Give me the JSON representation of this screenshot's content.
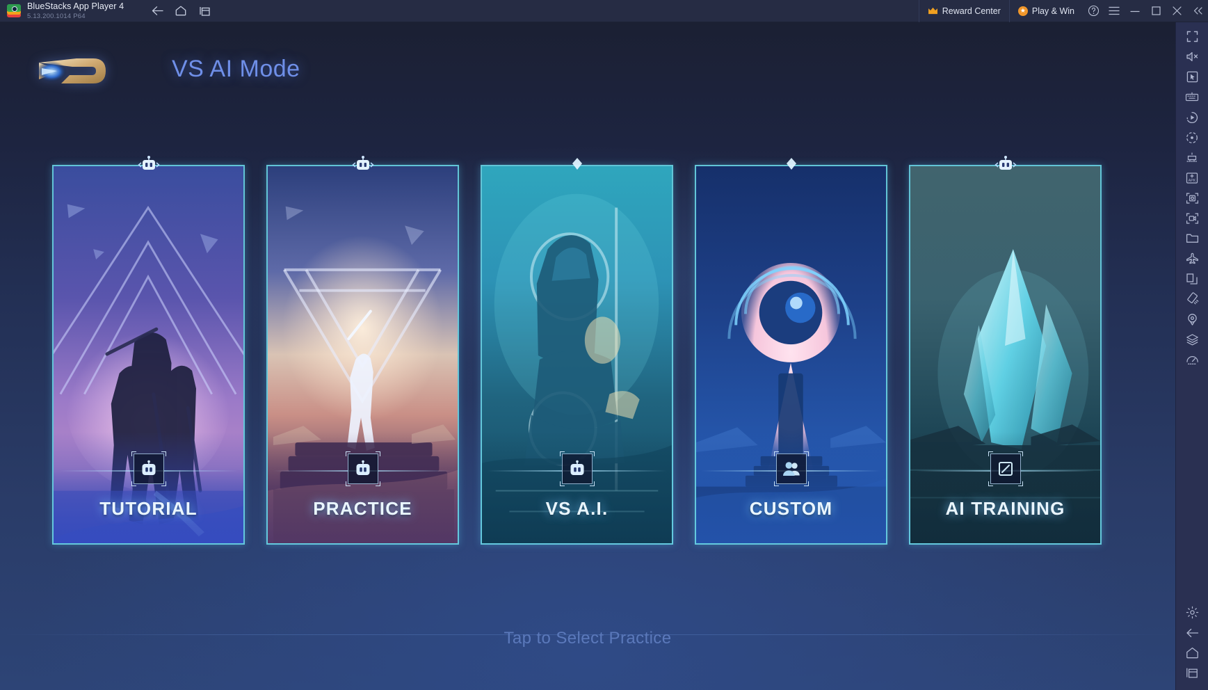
{
  "titlebar": {
    "logo_icon": "bluestacks-logo",
    "app_title": "BlueStacks App Player 4",
    "app_version": "5.13.200.1014  P64",
    "nav": [
      {
        "name": "back",
        "icon": "arrow-left-icon",
        "label": "Back"
      },
      {
        "name": "home",
        "icon": "home-icon",
        "label": "Home"
      },
      {
        "name": "multi-instance",
        "icon": "multi-instance-icon",
        "label": "Instance Manager"
      }
    ],
    "reward_center": {
      "label": "Reward Center",
      "icon": "crown-icon"
    },
    "play_and_win": {
      "label": "Play & Win",
      "icon": "coin-icon"
    },
    "help": {
      "icon": "help-circle-icon",
      "label": "Help"
    },
    "menu": {
      "icon": "hamburger-menu-icon",
      "label": "Menu"
    },
    "minimize": {
      "icon": "minimize-icon",
      "label": "Minimize"
    },
    "maximize": {
      "icon": "maximize-icon",
      "label": "Maximize"
    },
    "close": {
      "icon": "close-icon",
      "label": "Close"
    },
    "collapse": {
      "icon": "chevron-double-left-icon",
      "label": "Collapse Sidebar"
    }
  },
  "sidebar": {
    "items": [
      {
        "icon": "fullscreen-icon",
        "label": "Full screen"
      },
      {
        "icon": "mute-icon",
        "label": "Mute"
      },
      {
        "icon": "cursor-icon",
        "label": "Game controls"
      },
      {
        "icon": "keyboard-icon",
        "label": "Keymapping"
      },
      {
        "icon": "macro-play-icon",
        "label": "Macro recorder"
      },
      {
        "icon": "eco-mode-icon",
        "label": "Eco mode"
      },
      {
        "icon": "multi-instance-sync-icon",
        "label": "Multi-instance sync"
      },
      {
        "icon": "install-apk-icon",
        "label": "Install APK"
      },
      {
        "icon": "screenshot-icon",
        "label": "Screenshot"
      },
      {
        "icon": "record-screen-icon",
        "label": "Record screen"
      },
      {
        "icon": "media-manager-icon",
        "label": "Media manager"
      },
      {
        "icon": "airplane-icon",
        "label": "Location"
      },
      {
        "icon": "copy-icon",
        "label": "Copy to clipboard"
      },
      {
        "icon": "rotate-icon",
        "label": "Rotate"
      },
      {
        "icon": "location-pin-icon",
        "label": "Pin location"
      },
      {
        "icon": "layers-icon",
        "label": "Layers"
      },
      {
        "icon": "performance-icon",
        "label": "Performance"
      }
    ],
    "bottom_items": [
      {
        "icon": "gear-icon",
        "label": "Settings"
      },
      {
        "icon": "arrow-left-icon",
        "label": "Back"
      },
      {
        "icon": "home-icon",
        "label": "Home"
      },
      {
        "icon": "recent-apps-icon",
        "label": "Recent apps"
      }
    ]
  },
  "game": {
    "brand_icon": "game-brand-logo",
    "page_title": "VS AI Mode",
    "hint": "Tap to Select Practice",
    "cards": [
      {
        "label": "TUTORIAL",
        "badge_icon": "robot-icon",
        "top_icon": "robot-icon",
        "accent": "#7a6ad0",
        "art": "tutorial"
      },
      {
        "label": "PRACTICE",
        "badge_icon": "robot-icon",
        "top_icon": "robot-icon",
        "accent": "#d7a0a8",
        "art": "practice"
      },
      {
        "label": "VS A.I.",
        "badge_icon": "robot-icon",
        "top_icon": "diamond-icon",
        "accent": "#2f9fb5",
        "art": "vsai"
      },
      {
        "label": "CUSTOM",
        "badge_icon": "people-icon",
        "top_icon": "diamond-icon",
        "accent": "#e7b6c8",
        "art": "custom"
      },
      {
        "label": "AI TRAINING",
        "badge_icon": "slash-square-icon",
        "top_icon": "robot-icon",
        "accent": "#49a8b8",
        "art": "training"
      }
    ]
  }
}
